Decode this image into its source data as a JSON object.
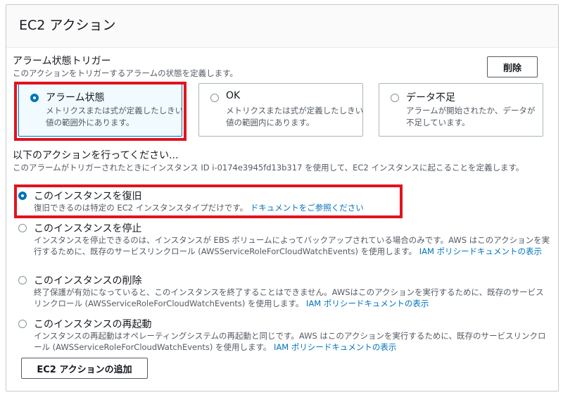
{
  "panel": {
    "title": "EC2 アクション"
  },
  "trigger": {
    "label": "アラーム状態トリガー",
    "description": "このアクションをトリガーするアラームの状態を定義します。",
    "delete_label": "削除",
    "tiles": [
      {
        "title": "アラーム状態",
        "description": "メトリクスまたは式が定義したしきい値の範囲外にあります。",
        "selected": true
      },
      {
        "title": "OK",
        "description": "メトリクスまたは式が定義したしきい値の範囲内にあります。",
        "selected": false
      },
      {
        "title": "データ不足",
        "description": "アラームが開始されたか、データが不足しています。",
        "selected": false
      }
    ]
  },
  "actions": {
    "label": "以下のアクションを行ってください...",
    "description": "このアラームがトリガーされたときにインスタンス ID i-0174e3945fd13b317 を使用して、EC2 インスタンスに起こることを定義します。",
    "options": [
      {
        "title": "このインスタンスを復旧",
        "description": "復旧できるのは特定の EC2 インスタンスタイプだけです。",
        "link": "ドキュメントをご参照ください",
        "selected": true
      },
      {
        "title": "このインスタンスを停止",
        "description": "インスタンスを停止できるのは、インスタンスが EBS ボリュームによってバックアップされている場合のみです。AWS はこのアクションを実行するために、既存のサービスリンクロール (AWSServiceRoleForCloudWatchEvents) を使用します。",
        "link": "IAM ポリシードキュメントの表示",
        "selected": false
      },
      {
        "title": "このインスタンスの削除",
        "description": "終了保護が有効になっていると、このインスタンスを終了することはできません。AWSはこのアクションを実行するために、既存のサービスリンクロール (AWSServiceRoleForCloudWatchEvents) を使用します。",
        "link": "IAM ポリシードキュメントの表示",
        "selected": false
      },
      {
        "title": "このインスタンスの再起動",
        "description": "インスタンスの再起動はオペレーティングシステムの再起動と同じです。AWS はこのアクションを実行するために、既存のサービスリンクロール (AWSServiceRoleForCloudWatchEvents) を使用します。",
        "link": "IAM ポリシードキュメントの表示",
        "selected": false
      }
    ],
    "add_label": "EC2 アクションの追加"
  },
  "colors": {
    "accent": "#0073bb",
    "highlight": "#e0141e",
    "border": "#aab7b8"
  }
}
